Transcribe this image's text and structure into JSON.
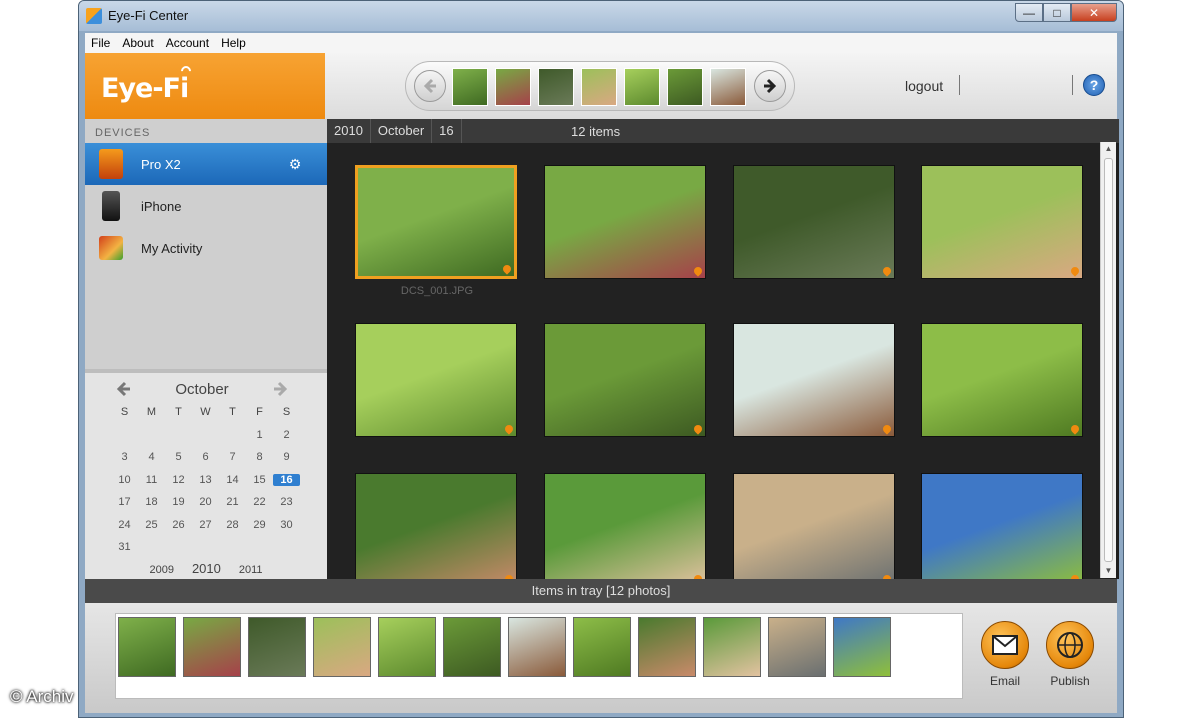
{
  "window": {
    "title": "Eye-Fi Center",
    "controls": [
      "minimize",
      "maximize",
      "close"
    ]
  },
  "menu": {
    "items": [
      "File",
      "About",
      "Account",
      "Help"
    ]
  },
  "header": {
    "brand": "Eye-Fi",
    "logout": "logout",
    "help": "?"
  },
  "sidebar": {
    "devices_label": "DEVICES",
    "devices": [
      {
        "label": "Pro X2",
        "icon": "sd-card-icon",
        "selected": true
      },
      {
        "label": "iPhone",
        "icon": "phone-icon",
        "selected": false
      },
      {
        "label": "My Activity",
        "icon": "activity-icon",
        "selected": false
      }
    ]
  },
  "calendar": {
    "month": "October",
    "days_of_week": [
      "S",
      "M",
      "T",
      "W",
      "T",
      "F",
      "S"
    ],
    "weeks": [
      [
        "",
        "",
        "",
        "",
        "",
        "1",
        "2"
      ],
      [
        "3",
        "4",
        "5",
        "6",
        "7",
        "8",
        "9"
      ],
      [
        "10",
        "11",
        "12",
        "13",
        "14",
        "15",
        "16"
      ],
      [
        "17",
        "18",
        "19",
        "20",
        "21",
        "22",
        "23"
      ],
      [
        "24",
        "25",
        "26",
        "27",
        "28",
        "29",
        "30"
      ],
      [
        "31",
        "",
        "",
        "",
        "",
        "",
        ""
      ]
    ],
    "selected_day": "16",
    "years": [
      "2009",
      "2010",
      "2011"
    ],
    "current_year": "2010"
  },
  "breadcrumb": {
    "year": "2010",
    "month": "October",
    "day": "16",
    "count": "12 items"
  },
  "photos": [
    {
      "colors": [
        "#7fb04a",
        "#3f6a22"
      ],
      "selected": true,
      "caption": "DCS_001.JPG"
    },
    {
      "colors": [
        "#78a944",
        "#a6414a"
      ]
    },
    {
      "colors": [
        "#3f5a2a",
        "#6a7a58"
      ]
    },
    {
      "colors": [
        "#9cc05a",
        "#d9a882"
      ]
    },
    {
      "colors": [
        "#a6cf5c",
        "#5d8a2e"
      ]
    },
    {
      "colors": [
        "#6b9a38",
        "#3d5a22"
      ]
    },
    {
      "colors": [
        "#d9e6e0",
        "#8a5a3a"
      ]
    },
    {
      "colors": [
        "#8dbd48",
        "#4f7a22"
      ]
    },
    {
      "colors": [
        "#4a7a2e",
        "#c98a6a"
      ]
    },
    {
      "colors": [
        "#5a9a3a",
        "#e2c2a0"
      ]
    },
    {
      "colors": [
        "#c9b08a",
        "#6a6f70"
      ]
    },
    {
      "colors": [
        "#3f78c6",
        "#8fbf3a"
      ]
    }
  ],
  "tray": {
    "label": "Items in tray [12 photos]",
    "email": "Email",
    "publish": "Publish"
  },
  "watermark": "© Archiv"
}
